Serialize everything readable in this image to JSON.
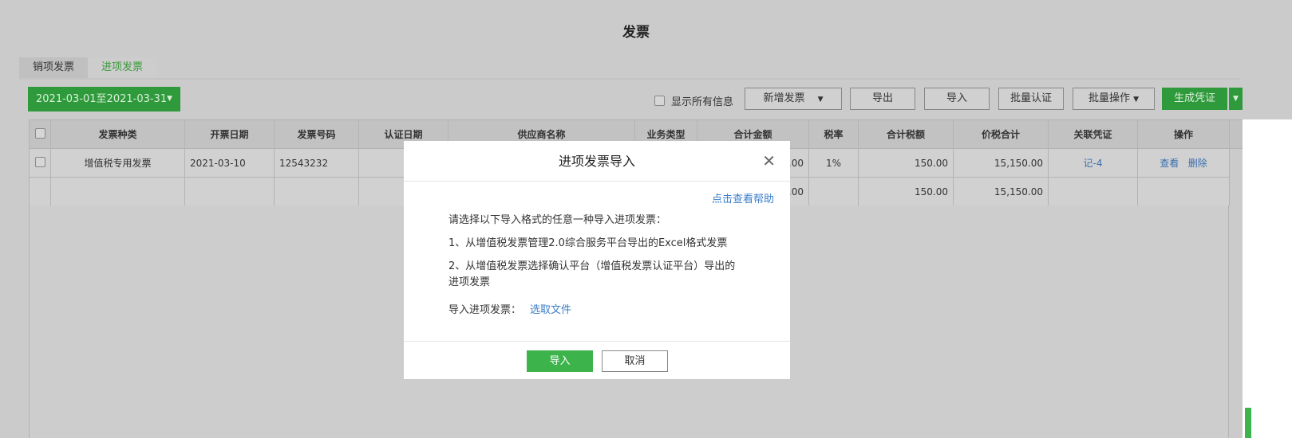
{
  "page": {
    "title": "发票"
  },
  "tabs": [
    {
      "label": "销项发票"
    },
    {
      "label": "进项发票"
    }
  ],
  "toolbar": {
    "date_range": "2021-03-01至2021-03-31",
    "show_all": "显示所有信息",
    "new_invoice": "新增发票",
    "export": "导出",
    "import": "导入",
    "batch_certify": "批量认证",
    "batch_ops": "批量操作",
    "gen_voucher": "生成凭证"
  },
  "table": {
    "headers": [
      "发票种类",
      "开票日期",
      "发票号码",
      "认证日期",
      "供应商名称",
      "业务类型",
      "合计金额",
      "税率",
      "合计税额",
      "价税合计",
      "关联凭证",
      "操作"
    ],
    "row": {
      "type": "增值税专用发票",
      "date": "2021-03-10",
      "number": "12543232",
      "cert_date": "",
      "supplier": "",
      "biz": "",
      "amount": ".00",
      "rate": "1%",
      "tax": "150.00",
      "total": "15,150.00",
      "voucher": "记-4",
      "view": "查看",
      "delete": "删除"
    },
    "sum": {
      "amount": ".00",
      "tax": "150.00",
      "total": "15,150.00"
    }
  },
  "modal": {
    "title": "进项发票导入",
    "help": "点击查看帮助",
    "intro": "请选择以下导入格式的任意一种导入进项发票：",
    "opt1": "1、从增值税发票管理2.0综合服务平台导出的Excel格式发票",
    "opt2": "2、从增值税发票选择确认平台（增值税发票认证平台）导出的进项发票",
    "file_label": "导入进项发票：",
    "file_link": "选取文件",
    "ok": "导入",
    "cancel": "取消"
  }
}
